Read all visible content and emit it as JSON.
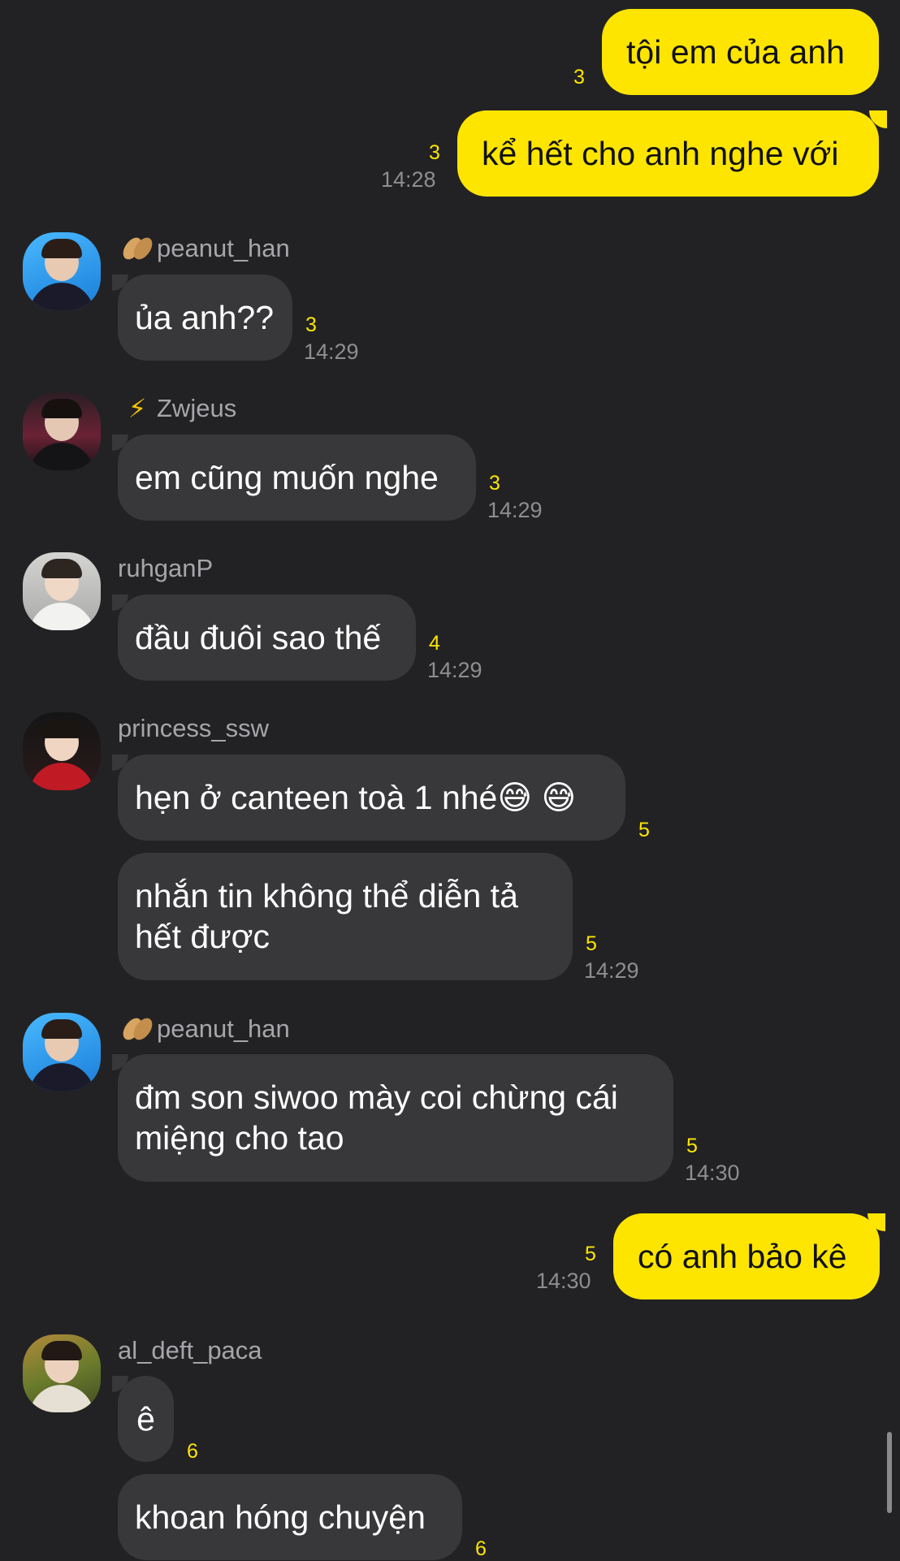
{
  "colors": {
    "background": "#222224",
    "outgoing_bubble": "#fde500",
    "incoming_bubble": "#38383a",
    "unread_count": "#fde500",
    "timestamp": "#8e8e92",
    "sender_name": "#a6a6aa"
  },
  "messages": {
    "m1": {
      "text": "tội em của anh",
      "unread": "3"
    },
    "m2": {
      "text": "kể hết cho anh nghe với",
      "unread": "3",
      "time": "14:28"
    },
    "m3": {
      "sender": "peanut_han",
      "sender_icon": "peanut-icon",
      "text": "ủa anh??",
      "unread": "3",
      "time": "14:29"
    },
    "m4": {
      "sender": "Zwjeus",
      "sender_icon": "lightning-icon",
      "sender_prefix": "⚡",
      "text": "em cũng muốn nghe",
      "unread": "3",
      "time": "14:29"
    },
    "m5": {
      "sender": "ruhganP",
      "text": "đầu đuôi sao thế",
      "unread": "4",
      "time": "14:29"
    },
    "m6": {
      "sender": "princess_ssw",
      "text": "hẹn ở canteen toà 1 nhé😅 😅",
      "unread": "5"
    },
    "m7": {
      "text": "nhắn tin không thể diễn tả hết được",
      "unread": "5",
      "time": "14:29"
    },
    "m8": {
      "sender": "peanut_han",
      "sender_icon": "peanut-icon",
      "text": "đm son siwoo mày coi chừng cái miệng cho tao",
      "unread": "5",
      "time": "14:30"
    },
    "m9": {
      "text": "có anh bảo kê",
      "unread": "5",
      "time": "14:30"
    },
    "m10": {
      "sender": "al_deft_paca",
      "text": "ê",
      "unread": "6"
    },
    "m11": {
      "text": "khoan hóng chuyện",
      "unread": "6"
    }
  }
}
